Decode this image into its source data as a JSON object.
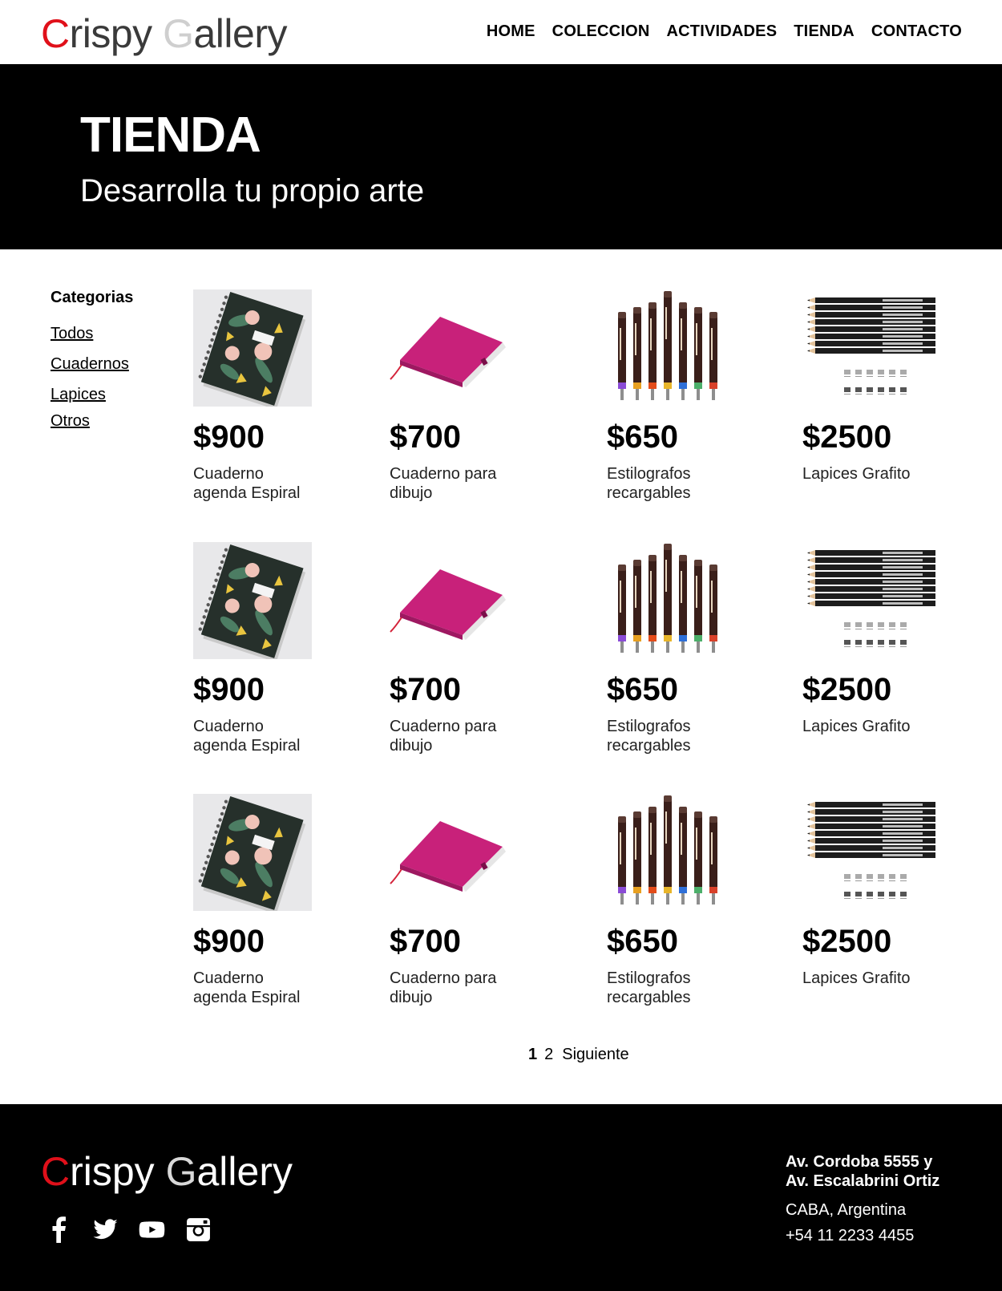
{
  "brand": {
    "first_letter": "C",
    "part1": "rispy ",
    "second_letter": "G",
    "part2": "allery"
  },
  "nav": [
    "HOME",
    "COLECCION",
    "ACTIVIDADES",
    "TIENDA",
    "CONTACTO"
  ],
  "hero": {
    "title": "TIENDA",
    "subtitle": "Desarrolla tu propio arte"
  },
  "sidebar": {
    "title": "Categorias",
    "items": [
      "Todos",
      "Cuadernos",
      "Lapices",
      "Otros"
    ]
  },
  "products": [
    {
      "price": "$900",
      "name": "Cuaderno agenda Espiral",
      "image": "spiral-notebook"
    },
    {
      "price": "$700",
      "name": "Cuaderno para dibujo",
      "image": "pink-notebook"
    },
    {
      "price": "$650",
      "name": "Estilografos recargables",
      "image": "technical-pens"
    },
    {
      "price": "$2500",
      "name": "Lapices Grafito",
      "image": "graphite-pencils"
    },
    {
      "price": "$900",
      "name": "Cuaderno agenda Espiral",
      "image": "spiral-notebook"
    },
    {
      "price": "$700",
      "name": "Cuaderno para dibujo",
      "image": "pink-notebook"
    },
    {
      "price": "$650",
      "name": "Estilografos recargables",
      "image": "technical-pens"
    },
    {
      "price": "$2500",
      "name": "Lapices Grafito",
      "image": "graphite-pencils"
    },
    {
      "price": "$900",
      "name": "Cuaderno agenda Espiral",
      "image": "spiral-notebook"
    },
    {
      "price": "$700",
      "name": "Cuaderno para dibujo",
      "image": "pink-notebook"
    },
    {
      "price": "$650",
      "name": "Estilografos recargables",
      "image": "technical-pens"
    },
    {
      "price": "$2500",
      "name": "Lapices Grafito",
      "image": "graphite-pencils"
    }
  ],
  "pagination": {
    "current": "1",
    "next_page": "2",
    "next_label": "Siguiente"
  },
  "footer": {
    "address_line1": "Av. Cordoba 5555 y",
    "address_line2": "Av. Escalabrini Ortiz",
    "city": "CABA, Argentina",
    "phone": "+54 11 2233 4455",
    "social": [
      "facebook-icon",
      "twitter-icon",
      "youtube-icon",
      "instagram-icon"
    ]
  },
  "colors": {
    "accent_red": "#e0101a",
    "logo_gray": "#cfcfcf",
    "hero_bg": "#000000",
    "notebook_pink": "#c8217a"
  }
}
